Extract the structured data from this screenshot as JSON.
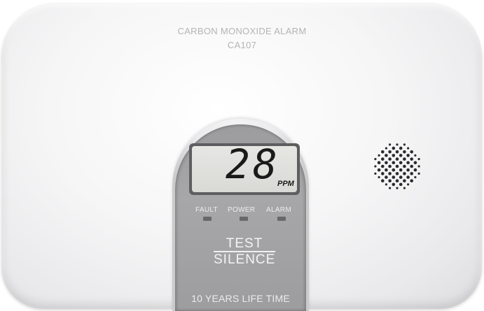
{
  "device": {
    "title": "CARBON MONOXIDE ALARM",
    "model": "CA107"
  },
  "display": {
    "reading": "28",
    "unit": "PPM"
  },
  "indicators": [
    {
      "label": "FAULT"
    },
    {
      "label": "POWER"
    },
    {
      "label": "ALARM"
    }
  ],
  "button": {
    "top": "TEST",
    "bottom": "SILENCE"
  },
  "footer": "10 YEARS LIFE TIME",
  "colors": {
    "body": "#f4f4f5",
    "face": "#a2a2a4",
    "lcd": "#dfdfdc",
    "digits": "#1a1a1a"
  }
}
